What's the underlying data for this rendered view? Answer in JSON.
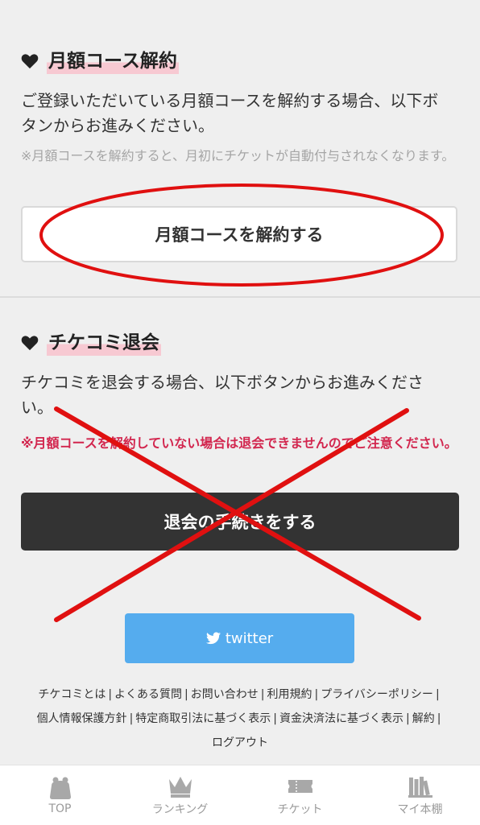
{
  "cancel_course": {
    "heading": "月額コース解約",
    "description": "ご登録いただいている月額コースを解約する場合、以下ボタンからお進みください。",
    "note": "※月額コースを解約すると、月初にチケットが自動付与されなくなります。",
    "button_label": "月額コースを解約する"
  },
  "withdraw": {
    "heading": "チケコミ退会",
    "description": "チケコミを退会する場合、以下ボタンからお進みください。",
    "warning": "※月額コースを解約していない場合は退会できませんのでご注意ください。",
    "button_label": "退会の手続きをする"
  },
  "twitter": {
    "label": "twitter",
    "icon": "twitter-icon",
    "color": "#55acee"
  },
  "footer_links": [
    "チケコミとは",
    "よくある質問",
    "お問い合わせ",
    "利用規約",
    "プライバシーポリシー",
    "個人情報保護方針",
    "特定商取引法に基づく表示",
    "資金決済法に基づく表示",
    "解約",
    "ログアウト"
  ],
  "tabbar": [
    {
      "label": "TOP",
      "icon": "top-icon"
    },
    {
      "label": "ランキング",
      "icon": "crown-icon"
    },
    {
      "label": "チケット",
      "icon": "ticket-icon"
    },
    {
      "label": "マイ本棚",
      "icon": "bookshelf-icon"
    }
  ],
  "annotation_color": "#e01010"
}
